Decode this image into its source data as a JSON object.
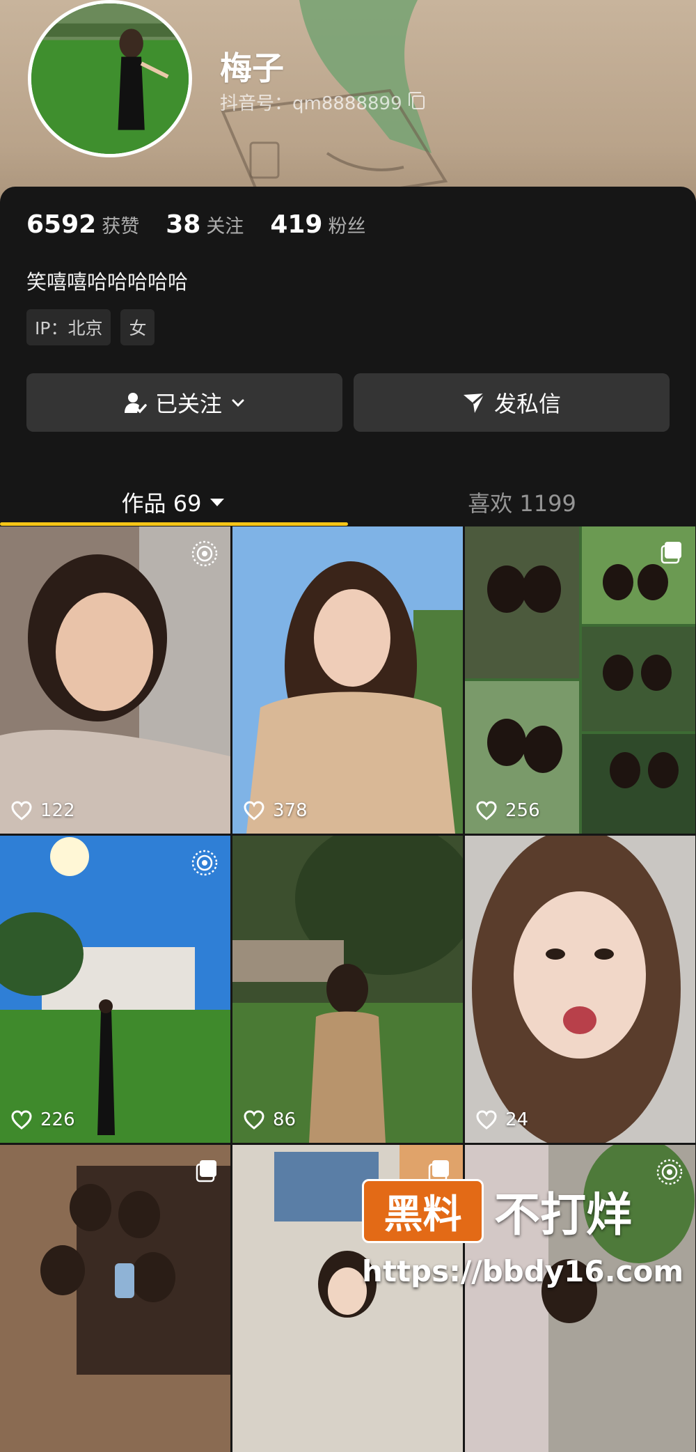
{
  "profile": {
    "name": "梅子",
    "douyin_id": "抖音号：qm8888899",
    "bio": "笑嘻嘻哈哈哈哈哈",
    "tags": [
      "IP：北京",
      "女"
    ]
  },
  "stats": [
    {
      "num": "6592",
      "label": "获赞"
    },
    {
      "num": "38",
      "label": "关注"
    },
    {
      "num": "419",
      "label": "粉丝"
    }
  ],
  "buttons": {
    "follow": "已关注",
    "message": "发私信"
  },
  "tabs": {
    "works": "作品 69",
    "likes": "喜欢 1199"
  },
  "videos": [
    {
      "likes": "122",
      "badge": "live-photo-icon"
    },
    {
      "likes": "378",
      "badge": ""
    },
    {
      "likes": "256",
      "badge": "gallery-icon"
    },
    {
      "likes": "226",
      "badge": "live-photo-icon"
    },
    {
      "likes": "86",
      "badge": ""
    },
    {
      "likes": "24",
      "badge": ""
    },
    {
      "likes": "",
      "badge": "gallery-icon"
    },
    {
      "likes": "",
      "badge": "gallery-icon"
    },
    {
      "likes": "",
      "badge": "live-photo-icon"
    }
  ],
  "watermark": {
    "logo": "黑料",
    "slogan": "不打烊",
    "url": "https://bbdy16.com"
  },
  "colors": {
    "accent": "#f5c518",
    "background": "#161616",
    "button": "#343434",
    "watermark_orange": "#e36a16"
  }
}
